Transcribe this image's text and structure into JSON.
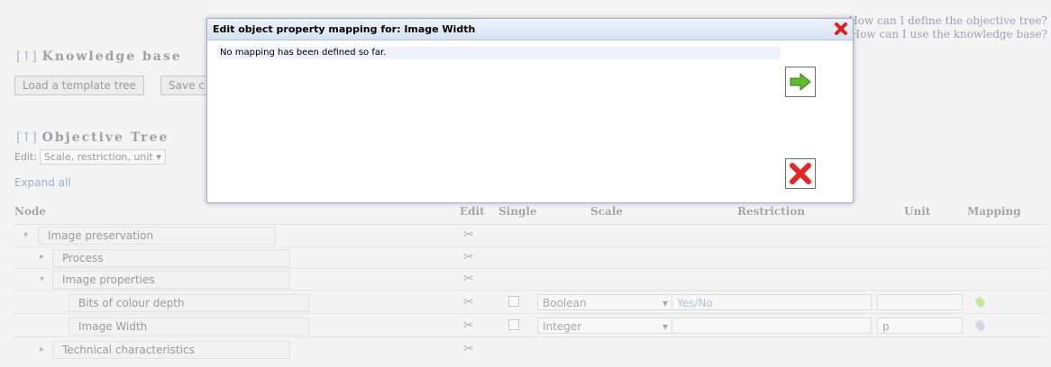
{
  "help": {
    "link1": "How can I define the objective tree?",
    "link2": "How can I use the knowledge base?"
  },
  "knowledge_base": {
    "up_label": "[↑]",
    "title": "Knowledge base",
    "load_button": "Load a template tree",
    "save_button_partial": "Save c"
  },
  "objective_tree": {
    "up_label": "[↑]",
    "title": "Objective Tree",
    "edit_label": "Edit:",
    "edit_value": "Scale, restriction, unit",
    "expand_all": "Expand all"
  },
  "table": {
    "headers": {
      "node": "Node",
      "edit": "Edit",
      "single": "Single",
      "scale": "Scale",
      "restriction": "Restriction",
      "unit": "Unit",
      "mapping": "Mapping"
    },
    "rows": [
      {
        "label": "Image preservation",
        "toggle": "collapse"
      },
      {
        "label": "Process",
        "toggle": "expand"
      },
      {
        "label": "Image properties",
        "toggle": "collapse"
      },
      {
        "label": "Bits of colour depth",
        "scale": "Boolean",
        "restriction": "Yes/No",
        "unit": ""
      },
      {
        "label": "Image Width",
        "scale": "Integer",
        "restriction": "",
        "unit": "p"
      },
      {
        "label": "Technical characteristics",
        "toggle": "expand"
      }
    ]
  },
  "dialog": {
    "title": "Edit object property mapping for: Image Width",
    "message": "No mapping has been defined so far."
  },
  "colors": {
    "dialog_border": "#9fb0c8",
    "confirm_green": "#4caf26",
    "cancel_red": "#e02020"
  }
}
